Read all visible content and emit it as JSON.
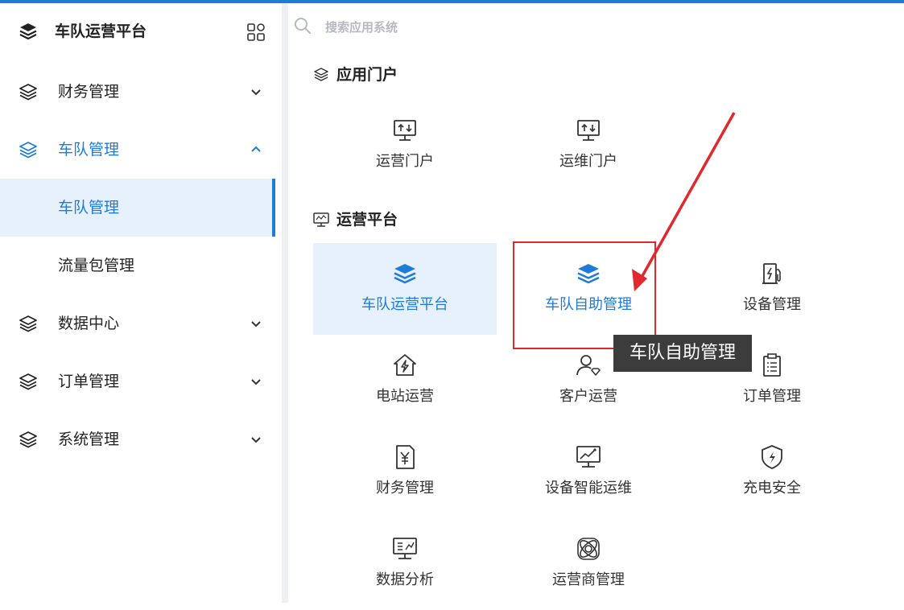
{
  "app": {
    "title": "车队运营平台"
  },
  "sidebar": {
    "menu": [
      {
        "label": "财务管理"
      },
      {
        "label": "车队管理"
      },
      {
        "label": "数据中心"
      },
      {
        "label": "订单管理"
      },
      {
        "label": "系统管理"
      }
    ],
    "submenu": [
      {
        "label": "车队管理"
      },
      {
        "label": "流量包管理"
      }
    ]
  },
  "search": {
    "placeholder": "搜索应用系统"
  },
  "sections": {
    "portal": {
      "title": "应用门户",
      "tiles": [
        {
          "label": "运营门户",
          "icon": "monitor-sync-icon"
        },
        {
          "label": "运维门户",
          "icon": "monitor-sync-icon"
        }
      ]
    },
    "platform": {
      "title": "运营平台",
      "tiles": [
        {
          "label": "车队运营平台",
          "icon": "layers-icon"
        },
        {
          "label": "车队自助管理",
          "icon": "layers-icon"
        },
        {
          "label": "设备管理",
          "icon": "charger-icon"
        },
        {
          "label": "电站运营",
          "icon": "house-bolt-icon"
        },
        {
          "label": "客户运营",
          "icon": "user-diamond-icon"
        },
        {
          "label": "订单管理",
          "icon": "clipboard-icon"
        },
        {
          "label": "财务管理",
          "icon": "yen-doc-icon"
        },
        {
          "label": "设备智能运维",
          "icon": "monitor-chart-icon"
        },
        {
          "label": "充电安全",
          "icon": "shield-bolt-icon"
        },
        {
          "label": "数据分析",
          "icon": "monitor-analytics-icon"
        },
        {
          "label": "运营商管理",
          "icon": "atom-icon"
        }
      ]
    }
  },
  "tooltip": {
    "text": "车队自助管理"
  },
  "colors": {
    "accent": "#1e7bd6",
    "active_bg": "#e6f1fb",
    "annotation": "#e0282e",
    "tooltip_bg": "#3c3c3c"
  }
}
